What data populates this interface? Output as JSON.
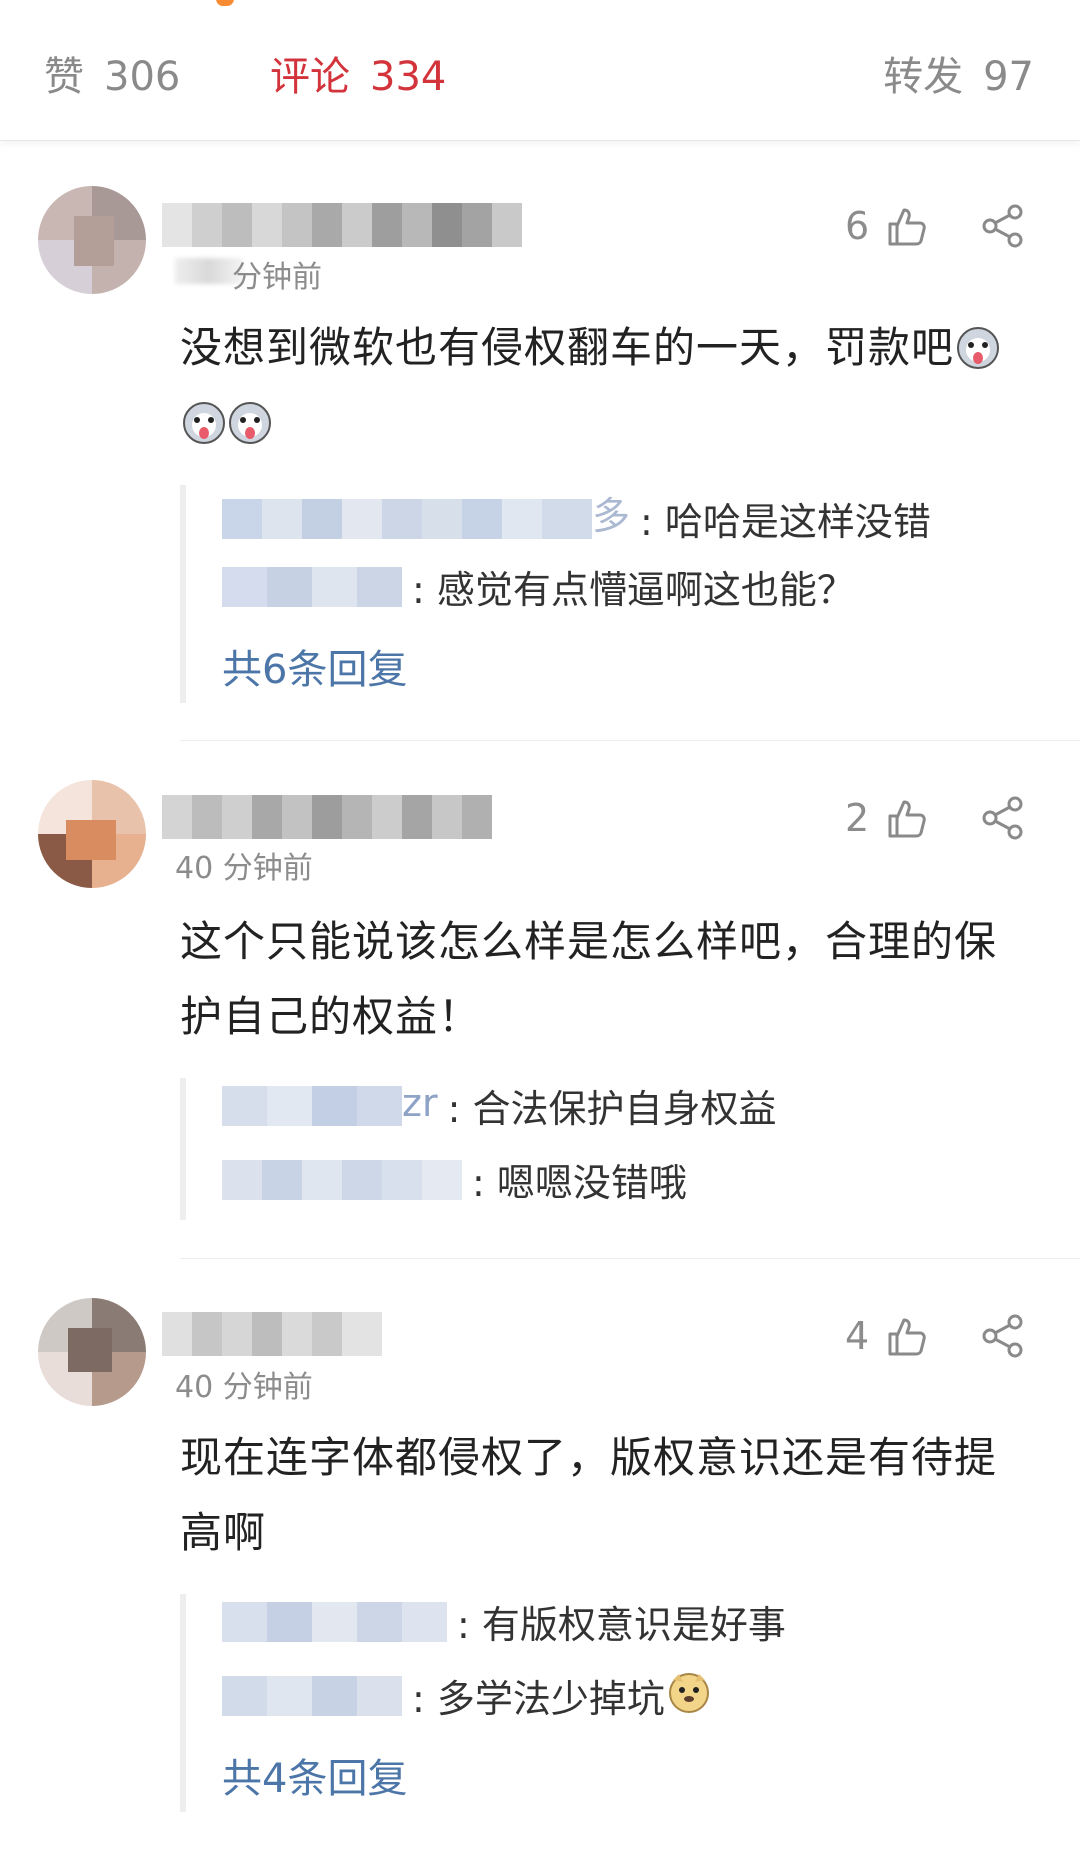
{
  "tabs": {
    "like_label": "赞",
    "like_count": "306",
    "comment_label": "评论",
    "comment_count": "334",
    "repost_label": "转发",
    "repost_count": "97"
  },
  "colors": {
    "active_tab": "#d3343c",
    "link": "#4d76a8",
    "meta": "#8c8c8c"
  },
  "comments": [
    {
      "time": "分钟前",
      "likes": "6",
      "text": "没想到微软也有侵权翻车的一天，罚款吧",
      "emoji": "husky-emoji",
      "replies": [
        {
          "name_tail": "多",
          "text": "哈哈是这样没错"
        },
        {
          "name_tail": "",
          "text": "感觉有点懵逼啊这也能？"
        }
      ],
      "more": "共6条回复"
    },
    {
      "time": "40 分钟前",
      "likes": "2",
      "text": "这个只能说该怎么样是怎么样吧，合理的保护自己的权益！",
      "replies": [
        {
          "name_tail": "zr",
          "text": "合法保护自身权益"
        },
        {
          "name_tail": "",
          "text": "嗯嗯没错哦"
        }
      ]
    },
    {
      "time": "40 分钟前",
      "likes": "4",
      "text": "现在连字体都侵权了，版权意识还是有待提高啊",
      "replies": [
        {
          "name_tail": "",
          "text": "有版权意识是好事"
        },
        {
          "name_tail": "",
          "text": "多学法少掉坑",
          "emoji": "doge-emoji"
        }
      ],
      "more": "共4条回复"
    }
  ]
}
